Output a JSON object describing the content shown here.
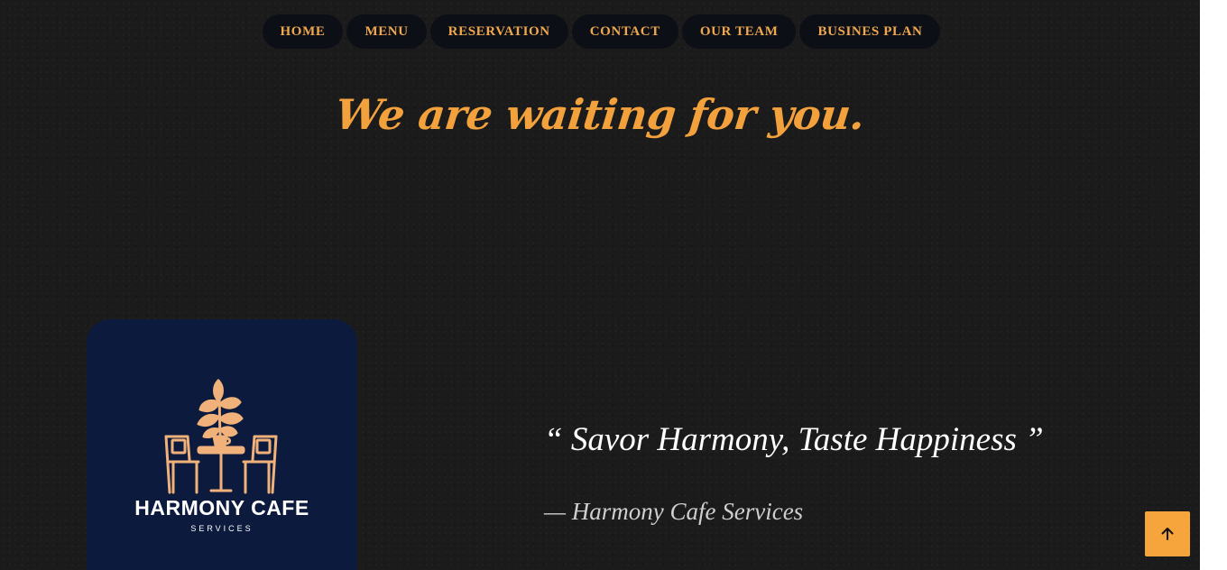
{
  "nav": {
    "items": [
      {
        "label": "HOME"
      },
      {
        "label": "MENU"
      },
      {
        "label": "RESERVATION"
      },
      {
        "label": "CONTACT"
      },
      {
        "label": "OUR TEAM"
      },
      {
        "label": "BUSINES PLAN"
      }
    ]
  },
  "hero": {
    "title": "We are waiting for you."
  },
  "logo": {
    "name": "HARMONY CAFE",
    "subtitle": "SERVICES",
    "icon": "cafe-table-chairs-plant-icon"
  },
  "testimonial": {
    "quote": "“ Savor Harmony, Taste Happiness ”",
    "attribution": "— Harmony Cafe Services"
  },
  "back_to_top": {
    "icon": "arrow-up-icon"
  },
  "colors": {
    "background": "#1b1b1b",
    "accent": "#f3a13c",
    "nav_pill": "#0d0f16",
    "logo_card": "#0c1a3d",
    "logo_art": "#f0b27a"
  }
}
